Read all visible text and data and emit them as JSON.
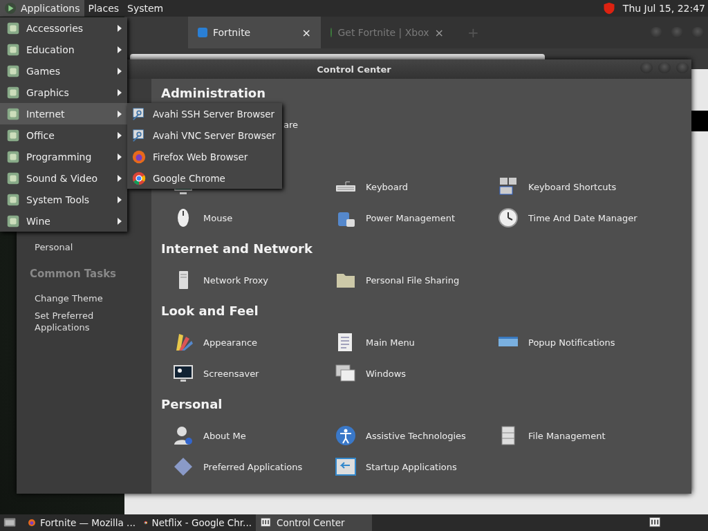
{
  "top_panel": {
    "menus": [
      {
        "label": "Applications",
        "selected": true
      },
      {
        "label": "Places",
        "selected": false
      },
      {
        "label": "System",
        "selected": false
      }
    ],
    "clock": "Thu Jul 15, 22:47"
  },
  "browser": {
    "tabs": [
      {
        "label": "Fortnite",
        "selected": true,
        "close": "×"
      },
      {
        "label": "Get Fortnite | Xbox",
        "selected": false,
        "close": "×"
      }
    ],
    "new_tab": "+"
  },
  "control_center": {
    "title": "Control Center",
    "sidebar": {
      "items": [
        "Personal"
      ],
      "common_tasks_title": "Common Tasks",
      "tasks": [
        "Change Theme",
        "Set Preferred Applications"
      ]
    },
    "sections": [
      {
        "title": "Administration",
        "items": [
          {
            "kind": "fragment",
            "label": "are"
          }
        ]
      },
      {
        "items": [
          {
            "kind": "item"
          },
          {
            "kind": "item",
            "label": "Keyboard"
          },
          {
            "kind": "item",
            "label": "Keyboard Shortcuts"
          },
          {
            "kind": "item",
            "label": "Mouse"
          },
          {
            "kind": "item",
            "label": "Power Management"
          },
          {
            "kind": "item",
            "label": "Time And Date Manager"
          }
        ]
      },
      {
        "title": "Internet and Network",
        "items": [
          {
            "kind": "item",
            "label": "Network Proxy"
          },
          {
            "kind": "item",
            "label": "Personal File Sharing"
          }
        ]
      },
      {
        "title": "Look and Feel",
        "items": [
          {
            "kind": "item",
            "label": "Appearance"
          },
          {
            "kind": "item",
            "label": "Main Menu"
          },
          {
            "kind": "item",
            "label": "Popup Notifications"
          },
          {
            "kind": "item",
            "label": "Screensaver"
          },
          {
            "kind": "item",
            "label": "Windows"
          }
        ]
      },
      {
        "title": "Personal",
        "items": [
          {
            "kind": "item",
            "label": "About Me"
          },
          {
            "kind": "item",
            "label": "Assistive Technologies"
          },
          {
            "kind": "item",
            "label": "File Management"
          },
          {
            "kind": "item",
            "label": "Preferred Applications"
          },
          {
            "kind": "item",
            "label": "Startup Applications"
          }
        ]
      }
    ]
  },
  "applications_menu": {
    "items": [
      {
        "label": "Accessories",
        "selected": false
      },
      {
        "label": "Education",
        "selected": false
      },
      {
        "label": "Games",
        "selected": false
      },
      {
        "label": "Graphics",
        "selected": false
      },
      {
        "label": "Internet",
        "selected": true
      },
      {
        "label": "Office",
        "selected": false
      },
      {
        "label": "Programming",
        "selected": false
      },
      {
        "label": "Sound & Video",
        "selected": false
      },
      {
        "label": "System Tools",
        "selected": false
      },
      {
        "label": "Wine",
        "selected": false
      }
    ],
    "submenu": [
      "Avahi SSH Server Browser",
      "Avahi VNC Server Browser",
      "Firefox Web Browser",
      "Google Chrome"
    ]
  },
  "taskbar": {
    "items": [
      {
        "label": "Fortnite — Mozilla ...",
        "selected": false
      },
      {
        "label": "Netflix - Google Chr...",
        "selected": false
      },
      {
        "label": "Control Center",
        "selected": true
      }
    ]
  }
}
